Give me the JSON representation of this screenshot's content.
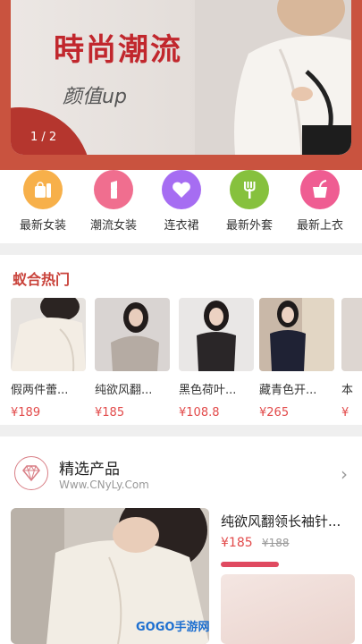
{
  "banner": {
    "title": "時尚潮流",
    "subtitle": "颜值up",
    "counter": "1 / 2"
  },
  "categories": [
    {
      "label": "最新女装",
      "icon": "bag-icon",
      "color": "#f7b04a"
    },
    {
      "label": "潮流女装",
      "icon": "lipstick-icon",
      "color": "#f06e8f"
    },
    {
      "label": "连衣裙",
      "icon": "heart-icon",
      "color": "#a66df2"
    },
    {
      "label": "最新外套",
      "icon": "fork-icon",
      "color": "#86c13d"
    },
    {
      "label": "最新上衣",
      "icon": "drink-icon",
      "color": "#ef5d92"
    }
  ],
  "hot": {
    "title": "蚁合热门",
    "items": [
      {
        "name": "假两件蕾...",
        "price": "¥189"
      },
      {
        "name": "纯欲风翻...",
        "price": "¥185"
      },
      {
        "name": "黑色荷叶...",
        "price": "¥108.8"
      },
      {
        "name": "藏青色开...",
        "price": "¥265"
      },
      {
        "name": "本",
        "price": "¥"
      }
    ]
  },
  "featured": {
    "title": "精选产品",
    "url": "Www.CNyLy.Com",
    "product_name": "纯欲风翻领长袖针...",
    "price": "¥185",
    "old_price": "¥188"
  },
  "watermark": "GOGO手游网",
  "colors": {
    "banner_red": "#c9533f",
    "accent_red": "#c9423a",
    "price_red": "#e24a4a"
  }
}
